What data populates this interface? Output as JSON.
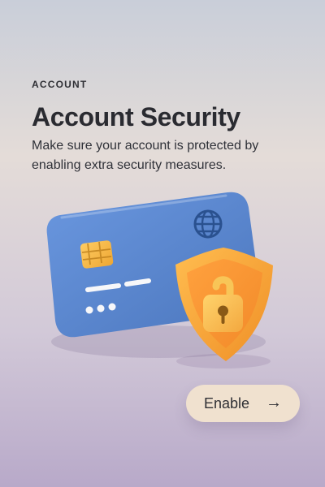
{
  "header": {
    "eyebrow": "ACCOUNT",
    "title": "Account Security",
    "subtitle": "Make sure your account is protected by enabling extra security measures."
  },
  "illustration": {
    "card_icon": "globe-icon",
    "shield_icon": "shield-icon",
    "lock_icon": "lock-icon"
  },
  "actions": {
    "enable_label": "Enable",
    "enable_icon": "arrow-right-icon"
  },
  "colors": {
    "card": "#5a86cf",
    "shield": "#f3a438",
    "lock": "#f7b54b",
    "button_bg": "#f0e1cf"
  }
}
